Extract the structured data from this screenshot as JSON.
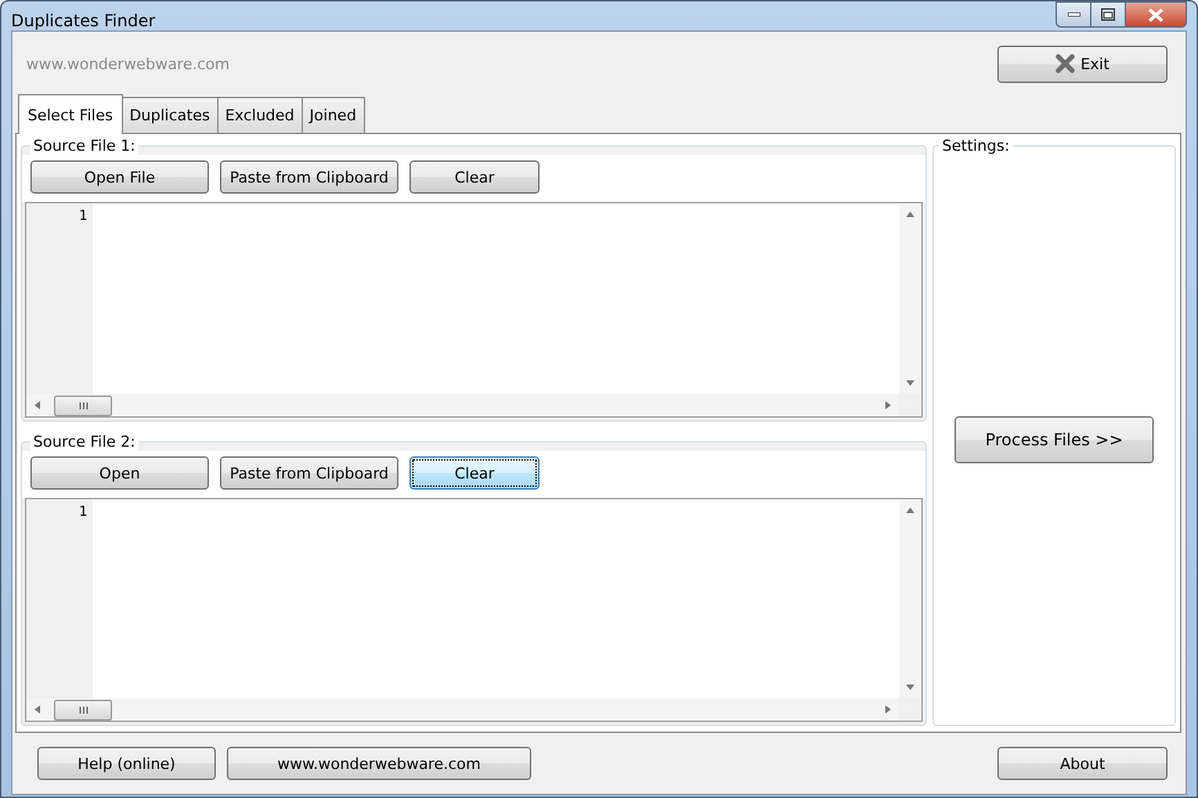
{
  "window": {
    "title": "Duplicates Finder"
  },
  "header": {
    "website": "www.wonderwebware.com",
    "exit_button": "Exit"
  },
  "tabs": [
    {
      "label": "Select Files",
      "selected": true
    },
    {
      "label": "Duplicates",
      "selected": false
    },
    {
      "label": "Excluded",
      "selected": false
    },
    {
      "label": "Joined",
      "selected": false
    }
  ],
  "sources": [
    {
      "legend": "Source File 1:",
      "buttons": [
        {
          "label": "Open File",
          "focused": false
        },
        {
          "label": "Paste from Clipboard",
          "focused": false
        },
        {
          "label": "Clear",
          "focused": false
        }
      ],
      "line_numbers": [
        "1"
      ]
    },
    {
      "legend": "Source File 2:",
      "buttons": [
        {
          "label": "Open",
          "focused": false
        },
        {
          "label": "Paste from Clipboard",
          "focused": false
        },
        {
          "label": "Clear",
          "focused": true
        }
      ],
      "line_numbers": [
        "1"
      ]
    }
  ],
  "settings": {
    "legend": "Settings:",
    "process_button": "Process Files  >>"
  },
  "footer": {
    "left_buttons": [
      "Help (online)",
      "www.wonderwebware.com"
    ],
    "right_button": "About"
  }
}
